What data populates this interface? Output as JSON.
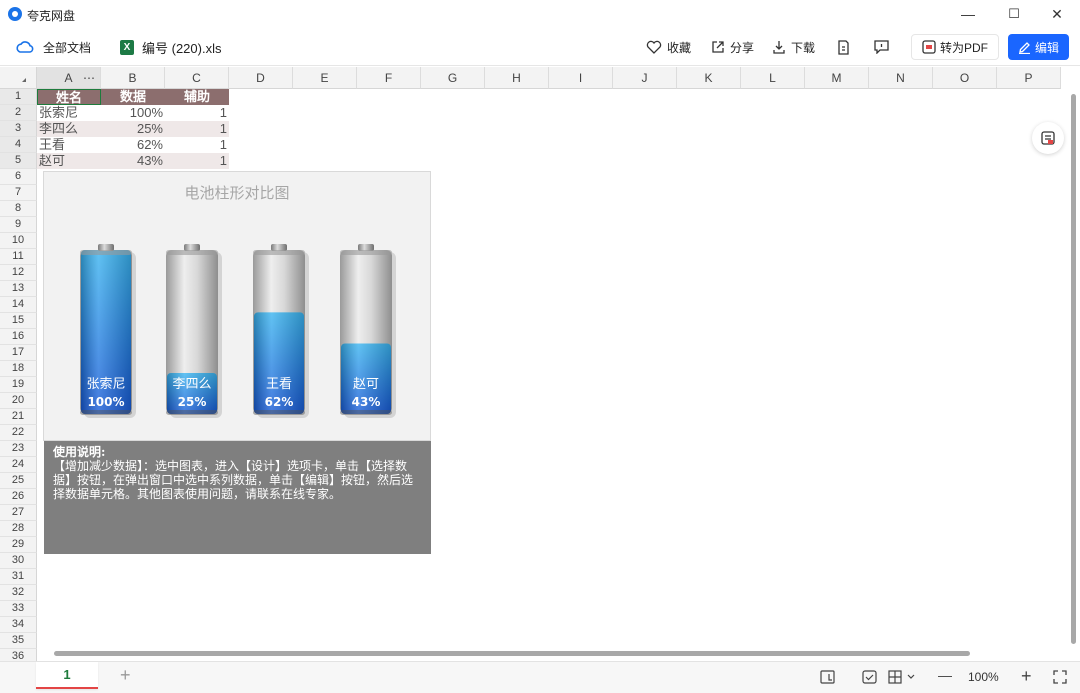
{
  "app": {
    "title": "夸克网盘"
  },
  "window": {
    "minimize": "—",
    "maximize": "☐",
    "close": "✕"
  },
  "toolbar": {
    "all_docs": "全部文档",
    "file_name": "编号 (220).xls",
    "xls_icon": "X",
    "favorite": "收藏",
    "share": "分享",
    "download": "下载",
    "to_pdf": "转为PDF",
    "edit": "编辑"
  },
  "sheet": {
    "columns": [
      "A",
      "B",
      "C",
      "D",
      "E",
      "F",
      "G",
      "H",
      "I",
      "J",
      "K",
      "L",
      "M",
      "N",
      "O",
      "P"
    ],
    "rows": [
      "1",
      "2",
      "3",
      "4",
      "5",
      "6",
      "7",
      "8",
      "9",
      "10",
      "11",
      "12",
      "13",
      "14",
      "15",
      "16",
      "17",
      "18",
      "19",
      "20",
      "21",
      "22",
      "23",
      "24",
      "25",
      "26",
      "27",
      "28",
      "29",
      "30",
      "31",
      "32",
      "33",
      "34",
      "35",
      "36"
    ],
    "col_a_more": "⋯",
    "headers": [
      "姓名",
      "数据",
      "辅助"
    ],
    "data": [
      {
        "name": "张索尼",
        "value": "100%",
        "aux": "1"
      },
      {
        "name": "李四么",
        "value": "25%",
        "aux": "1"
      },
      {
        "name": "王看",
        "value": "62%",
        "aux": "1"
      },
      {
        "name": "赵可",
        "value": "43%",
        "aux": "1"
      }
    ]
  },
  "chart_data": {
    "type": "bar",
    "title": "电池柱形对比图",
    "categories": [
      "张索尼",
      "李四么",
      "王看",
      "赵可"
    ],
    "values": [
      1.0,
      0.25,
      0.62,
      0.43
    ],
    "value_labels": [
      "100%",
      "25%",
      "62%",
      "43%"
    ],
    "ylim": [
      0,
      1
    ],
    "grid": false,
    "legend": "none",
    "colors": {
      "fill": "#1e6fd9",
      "empty": "#cfcfcf",
      "header": "#8c6e6e"
    }
  },
  "note": {
    "heading": "使用说明:",
    "body": "【增加减少数据】：选中图表，进入【设计】选项卡，单击【选择数据】按钮，在弹出窗口中选中系列数据，单击【编辑】按钮，然后选择数据单元格。其他图表使用问题，请联系在线专家。"
  },
  "bottom": {
    "sheet_tab": "1",
    "add_tab": "+",
    "zoom": "100%",
    "zoom_out": "—",
    "zoom_in": "+"
  }
}
